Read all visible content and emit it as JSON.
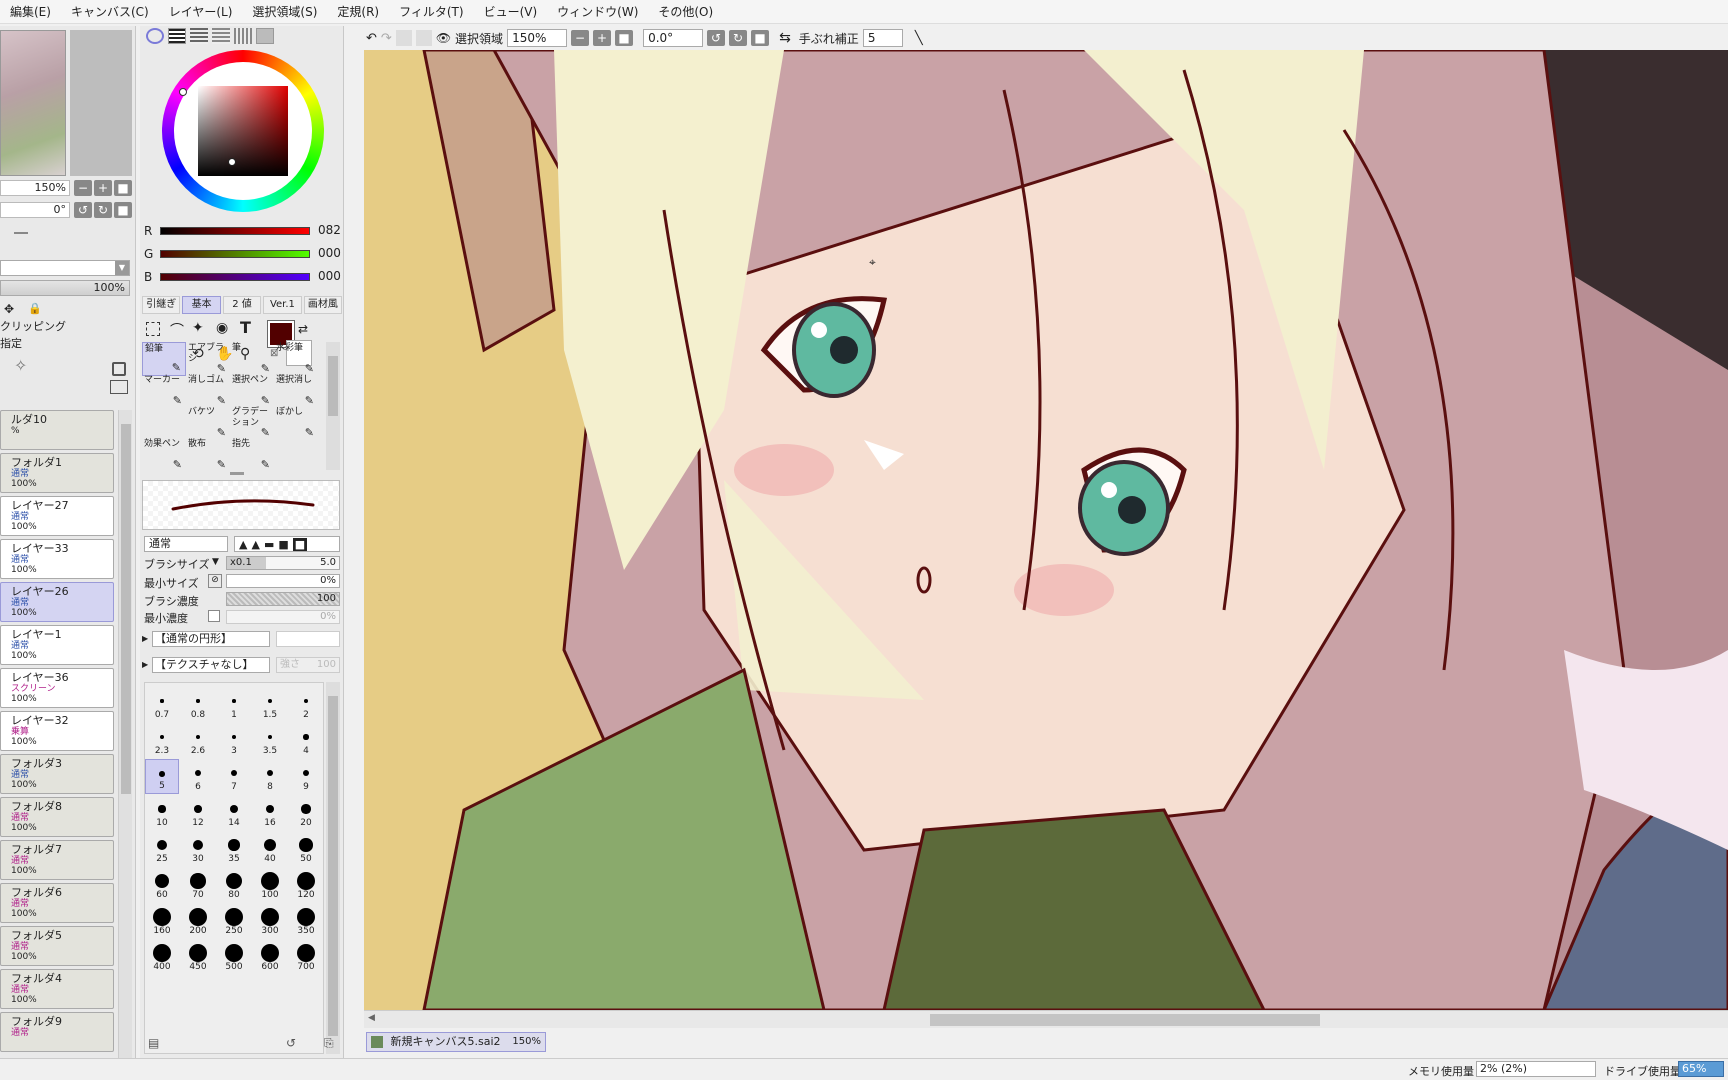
{
  "menu": [
    "編集(E)",
    "キャンバス(C)",
    "レイヤー(L)",
    "選択領域(S)",
    "定規(R)",
    "フィルタ(T)",
    "ビュー(V)",
    "ウィンドウ(W)",
    "その他(O)"
  ],
  "navigator": {
    "zoom": "150%",
    "angle": "0°"
  },
  "layer_panel": {
    "opacity": "100%",
    "clipping_label": "クリッピング",
    "specify_label": "指定",
    "layers": [
      {
        "name": "ルダ10",
        "mode": "",
        "opacity": "%",
        "folder": true
      },
      {
        "name": "フォルダ1",
        "mode": "通常",
        "opacity": "100%",
        "folder": true
      },
      {
        "name": "レイヤー27",
        "mode": "通常",
        "opacity": "100%"
      },
      {
        "name": "レイヤー33",
        "mode": "通常",
        "opacity": "100%"
      },
      {
        "name": "レイヤー26",
        "mode": "通常",
        "opacity": "100%",
        "selected": true
      },
      {
        "name": "レイヤー1",
        "mode": "通常",
        "opacity": "100%"
      },
      {
        "name": "レイヤー36",
        "mode": "スクリーン",
        "opacity": "100%",
        "alt": true
      },
      {
        "name": "レイヤー32",
        "mode": "乗算",
        "opacity": "100%",
        "alt": true
      },
      {
        "name": "フォルダ3",
        "mode": "通常",
        "opacity": "100%",
        "folder": true
      },
      {
        "name": "フォルダ8",
        "mode": "通常",
        "opacity": "100%",
        "folder": true,
        "alt": true
      },
      {
        "name": "フォルダ7",
        "mode": "通常",
        "opacity": "100%",
        "folder": true,
        "alt": true
      },
      {
        "name": "フォルダ6",
        "mode": "通常",
        "opacity": "100%",
        "folder": true,
        "alt": true
      },
      {
        "name": "フォルダ5",
        "mode": "通常",
        "opacity": "100%",
        "folder": true,
        "alt": true
      },
      {
        "name": "フォルダ4",
        "mode": "通常",
        "opacity": "100%",
        "folder": true,
        "alt": true
      },
      {
        "name": "フォルダ9",
        "mode": "通常",
        "opacity": "",
        "folder": true,
        "alt": true
      }
    ]
  },
  "color": {
    "r": "082",
    "g": "000",
    "b": "000",
    "swatch": "#520000"
  },
  "tool_tabs": [
    "引継ぎ",
    "基本",
    "2 値",
    "Ver.1",
    "画材風"
  ],
  "tools": [
    {
      "name": "鉛筆",
      "selected": true
    },
    {
      "name": "エアブラシ"
    },
    {
      "name": "筆"
    },
    {
      "name": "水彩筆"
    },
    {
      "name": "マーカー"
    },
    {
      "name": "消しゴム"
    },
    {
      "name": "選択ペン"
    },
    {
      "name": "選択消し"
    },
    {
      "name": ""
    },
    {
      "name": "バケツ"
    },
    {
      "name": "グラデーション"
    },
    {
      "name": "ぼかし"
    },
    {
      "name": "効果ペン"
    },
    {
      "name": "散布"
    },
    {
      "name": "指先"
    },
    {
      "name": ""
    }
  ],
  "brush": {
    "blend_mode": "通常",
    "size_label": "ブラシサイズ",
    "size_mult": "x0.1",
    "size_value": "5.0",
    "min_size_label": "最小サイズ",
    "min_size_value": "0%",
    "density_label": "ブラシ濃度",
    "density_value": "100",
    "min_density_label": "最小濃度",
    "min_density_value": "0%",
    "shape": "【通常の円形】",
    "texture": "【テクスチャなし】",
    "texture_strength": "強さ",
    "texture_value": "100"
  },
  "brush_sizes": [
    "0.7",
    "0.8",
    "1",
    "1.5",
    "2",
    "2.3",
    "2.6",
    "3",
    "3.5",
    "4",
    "5",
    "6",
    "7",
    "8",
    "9",
    "10",
    "12",
    "14",
    "16",
    "20",
    "25",
    "30",
    "35",
    "40",
    "50",
    "60",
    "70",
    "80",
    "100",
    "120",
    "160",
    "200",
    "250",
    "300",
    "350",
    "400",
    "450",
    "500",
    "600",
    "700"
  ],
  "selected_brush_size": "5",
  "canvas_toolbar": {
    "selection_label": "選択領域",
    "zoom": "150%",
    "rotation": "0.0°",
    "stabilizer_label": "手ぶれ補正",
    "stabilizer_value": "5"
  },
  "document": {
    "filename": "新規キャンバス5.sai2",
    "zoom": "150%"
  },
  "status": {
    "memory_label": "メモリ使用量",
    "memory_value": "2% (2%)",
    "drive_label": "ドライブ使用量",
    "drive_value": "65%"
  }
}
